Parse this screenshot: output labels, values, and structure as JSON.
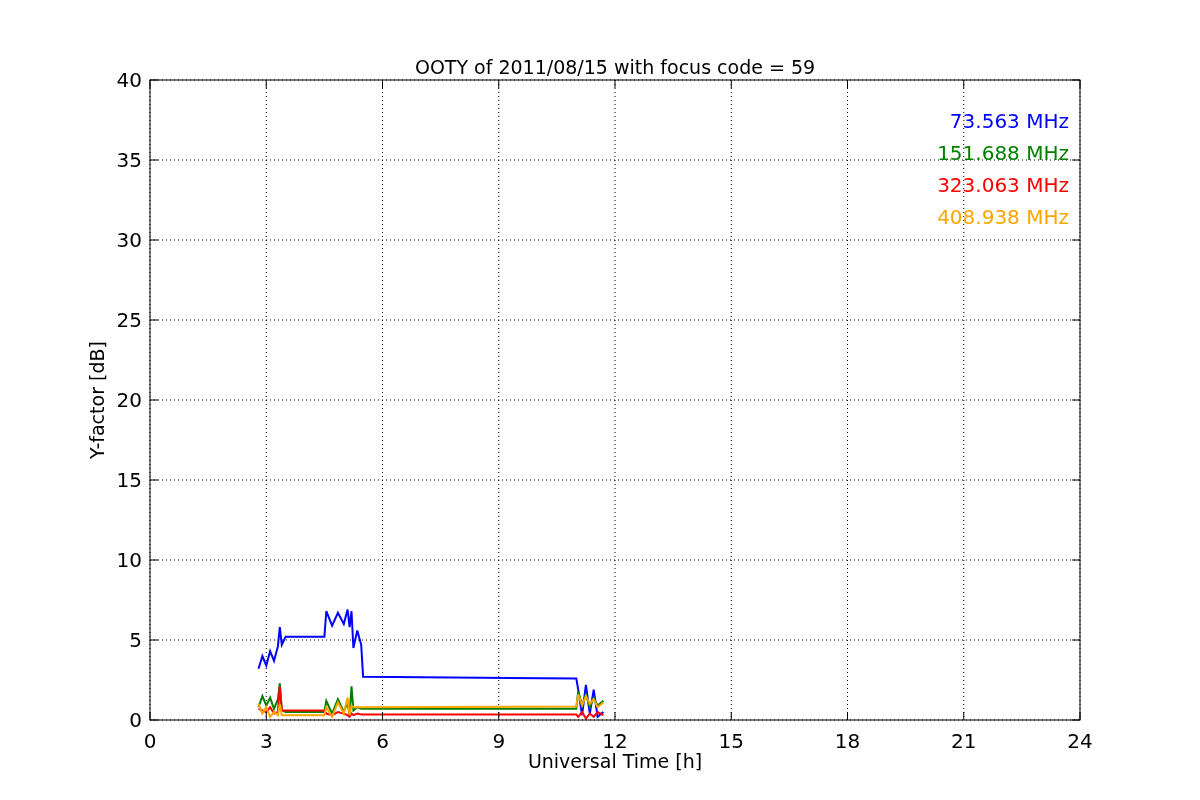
{
  "chart_data": {
    "type": "line",
    "title": "OOTY of 2011/08/15 with focus code = 59",
    "xlabel": "Universal Time [h]",
    "ylabel": "Y-factor [dB]",
    "x": [
      2.8,
      2.9,
      3.0,
      3.1,
      3.2,
      3.3,
      3.35,
      3.4,
      3.5,
      4.5,
      4.55,
      4.7,
      4.85,
      5.0,
      5.1,
      5.15,
      5.2,
      5.25,
      5.35,
      5.45,
      5.5,
      11.0,
      11.05,
      11.15,
      11.25,
      11.35,
      11.45,
      11.55,
      11.7
    ],
    "series": [
      {
        "name": "73.563 MHz",
        "color": "#0000ff",
        "values": [
          3.2,
          4.0,
          3.4,
          4.3,
          3.7,
          4.6,
          5.8,
          4.7,
          5.2,
          5.2,
          6.8,
          5.9,
          6.7,
          6.0,
          6.9,
          5.8,
          6.8,
          4.5,
          5.6,
          4.7,
          2.7,
          2.6,
          1.9,
          0.3,
          2.2,
          0.4,
          1.9,
          0.2,
          0.5
        ]
      },
      {
        "name": "151.688 MHz",
        "color": "#008000",
        "values": [
          0.8,
          1.5,
          0.9,
          1.4,
          0.7,
          1.3,
          2.3,
          0.6,
          0.5,
          0.5,
          1.2,
          0.4,
          1.3,
          0.5,
          1.1,
          0.3,
          2.1,
          0.6,
          0.8,
          0.7,
          0.7,
          0.7,
          1.8,
          0.9,
          1.6,
          0.8,
          1.4,
          0.9,
          1.2
        ]
      },
      {
        "name": "323.063 MHz",
        "color": "#ff0000",
        "values": [
          0.7,
          0.6,
          0.5,
          0.8,
          0.4,
          0.5,
          2.1,
          0.6,
          0.6,
          0.6,
          0.4,
          0.3,
          0.5,
          0.4,
          0.3,
          0.2,
          0.4,
          0.3,
          0.4,
          0.35,
          0.35,
          0.35,
          0.2,
          0.5,
          0.1,
          0.4,
          0.2,
          0.5,
          0.3
        ]
      },
      {
        "name": "408.938 MHz",
        "color": "#ffa500",
        "values": [
          1.0,
          0.4,
          0.8,
          0.2,
          0.5,
          0.3,
          1.0,
          0.3,
          0.3,
          0.3,
          0.8,
          0.2,
          1.1,
          0.4,
          1.4,
          0.3,
          0.9,
          0.8,
          0.8,
          0.8,
          0.8,
          0.85,
          1.6,
          0.9,
          1.5,
          1.0,
          1.3,
          0.8,
          1.1
        ]
      }
    ],
    "grid": true,
    "xlim": [
      0,
      24
    ],
    "ylim": [
      0,
      40
    ],
    "xticks": [
      0,
      3,
      6,
      9,
      12,
      15,
      18,
      21,
      24
    ],
    "yticks": [
      0,
      5,
      10,
      15,
      20,
      25,
      30,
      35,
      40
    ]
  }
}
